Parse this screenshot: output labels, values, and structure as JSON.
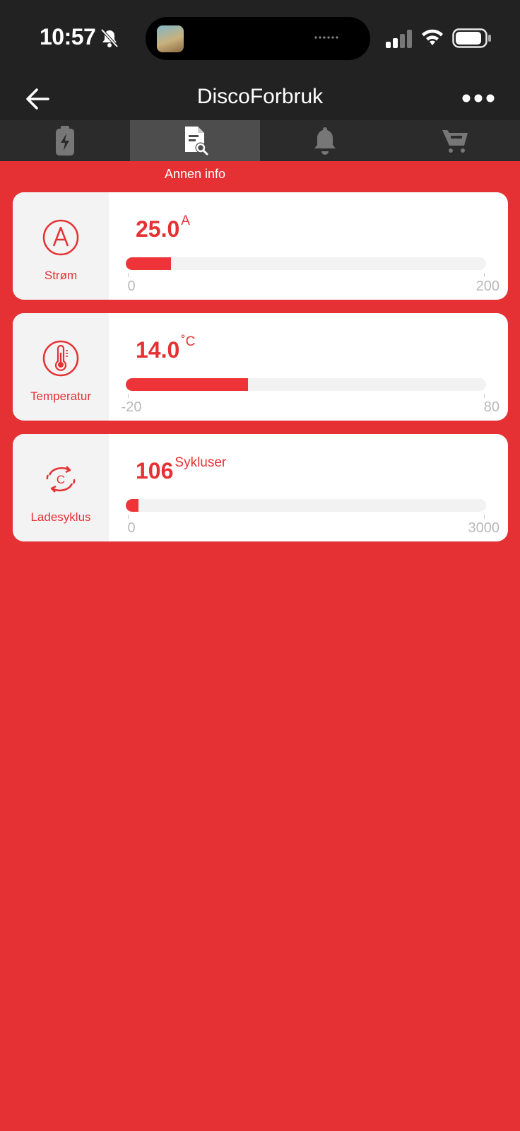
{
  "status_bar": {
    "time": "10:57"
  },
  "header": {
    "title": "DiscoForbruk"
  },
  "tabs": [
    {
      "icon": "battery-charging-icon",
      "active": false
    },
    {
      "icon": "document-search-icon",
      "active": true,
      "label": "Annen info"
    },
    {
      "icon": "bell-icon",
      "active": false
    },
    {
      "icon": "cart-icon",
      "active": false
    }
  ],
  "active_tab_label": "Annen info",
  "cards": [
    {
      "name": "Strøm",
      "value": "25.0",
      "unit": "A",
      "min": "0",
      "max": "200",
      "fill_fraction": 0.125
    },
    {
      "name": "Temperatur",
      "value": "14.0",
      "unit": "˚C",
      "min": "-20",
      "max": "80",
      "fill_fraction": 0.34
    },
    {
      "name": "Ladesyklus",
      "value": "106",
      "unit": "Sykluser",
      "min": "0",
      "max": "3000",
      "fill_fraction": 0.035
    }
  ],
  "colors": {
    "accent": "#e53134",
    "bar": "#ee3438",
    "header_bg": "#222222"
  }
}
